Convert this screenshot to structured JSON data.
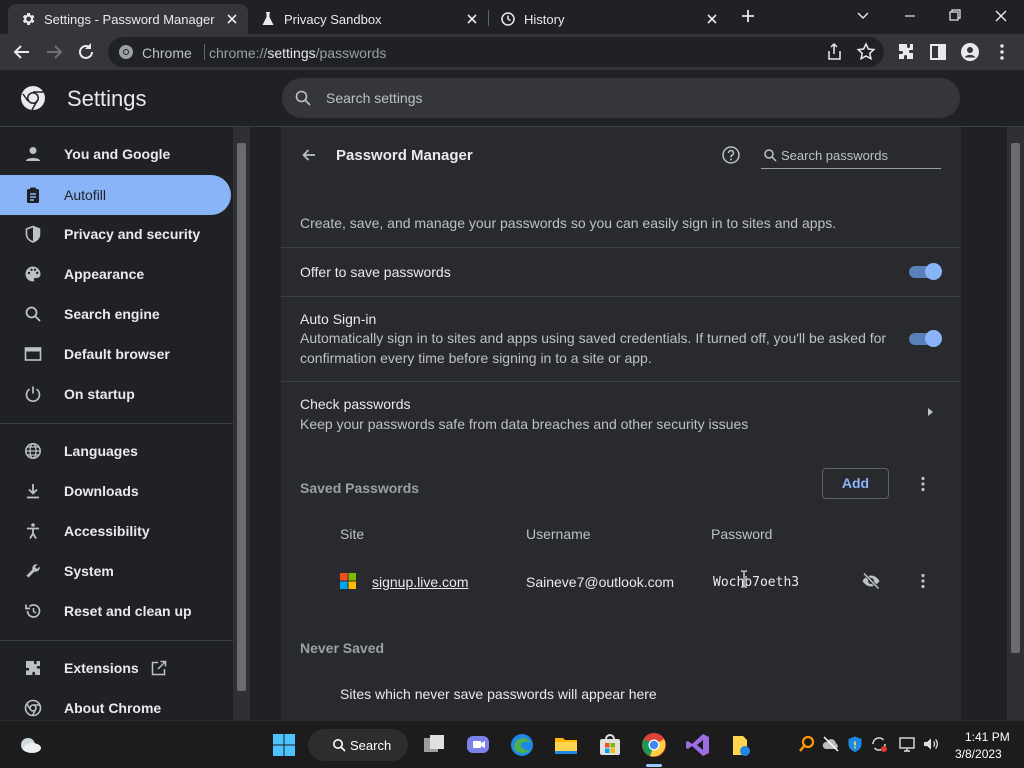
{
  "tabs": [
    {
      "title": "Settings - Password Manager",
      "icon": "gear-icon",
      "active": true
    },
    {
      "title": "Privacy Sandbox",
      "icon": "flask-icon",
      "active": false
    },
    {
      "title": "History",
      "icon": "history-icon",
      "active": false
    }
  ],
  "omnibox": {
    "chip": "Chrome",
    "url_prefix": "chrome://",
    "url_host": "settings",
    "url_path": "/passwords"
  },
  "header": {
    "title": "Settings",
    "search_placeholder": "Search settings"
  },
  "sidebar": {
    "items": [
      {
        "label": "You and Google",
        "icon": "person-icon"
      },
      {
        "label": "Autofill",
        "icon": "clipboard-icon",
        "active": true
      },
      {
        "label": "Privacy and security",
        "icon": "shield-icon"
      },
      {
        "label": "Appearance",
        "icon": "palette-icon"
      },
      {
        "label": "Search engine",
        "icon": "search-icon"
      },
      {
        "label": "Default browser",
        "icon": "browser-icon"
      },
      {
        "label": "On startup",
        "icon": "power-icon"
      },
      {
        "label": "Languages",
        "icon": "globe-icon"
      },
      {
        "label": "Downloads",
        "icon": "download-icon"
      },
      {
        "label": "Accessibility",
        "icon": "accessibility-icon"
      },
      {
        "label": "System",
        "icon": "wrench-icon"
      },
      {
        "label": "Reset and clean up",
        "icon": "restore-icon"
      },
      {
        "label": "Extensions",
        "icon": "puzzle-icon"
      },
      {
        "label": "About Chrome",
        "icon": "chrome-icon"
      }
    ]
  },
  "password_manager": {
    "title": "Password Manager",
    "search_placeholder": "Search passwords",
    "description": "Create, save, and manage your passwords so you can easily sign in to sites and apps.",
    "offer_to_save": {
      "label": "Offer to save passwords",
      "enabled": true
    },
    "auto_signin": {
      "label": "Auto Sign-in",
      "sub_line1": "Automatically sign in to sites and apps using saved credentials. If turned off, you'll be asked for",
      "sub_line2": "confirmation every time before signing in to a site or app.",
      "enabled": true
    },
    "check_passwords": {
      "label": "Check passwords",
      "sub": "Keep your passwords safe from data breaches and other security issues"
    },
    "saved_passwords": {
      "label": "Saved Passwords",
      "add_label": "Add",
      "columns": {
        "site": "Site",
        "username": "Username",
        "password": "Password"
      },
      "rows": [
        {
          "site": "signup.live.com",
          "username": "Saineve7@outlook.com",
          "password": "Wochb7oeth3"
        }
      ]
    },
    "never_saved": {
      "label": "Never Saved",
      "note": "Sites which never save passwords will appear here"
    }
  },
  "taskbar": {
    "search_label": "Search",
    "time": "1:41 PM",
    "date": "3/8/2023"
  },
  "colors": {
    "accent": "#8ab4f8",
    "background": "#202124",
    "card": "#292a2d"
  }
}
